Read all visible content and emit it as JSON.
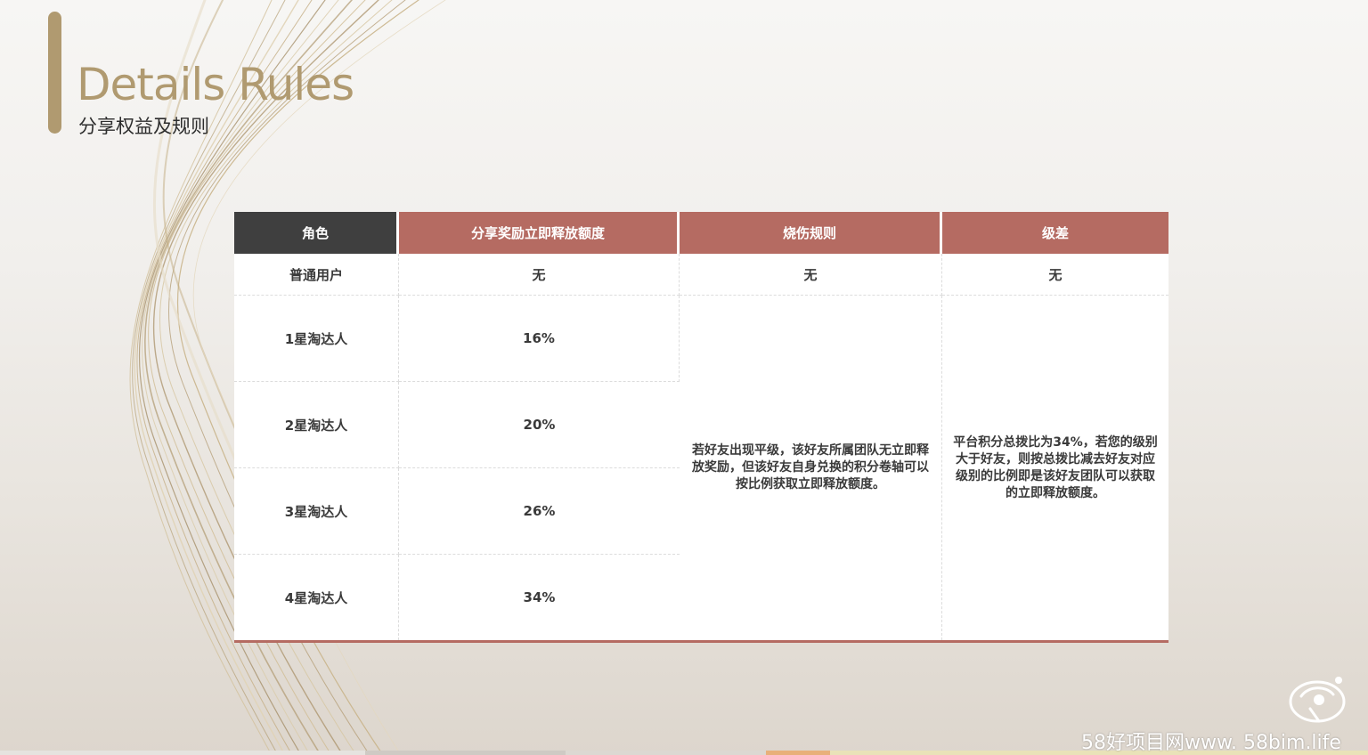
{
  "slide": {
    "title_en": "Details Rules",
    "title_cn": "分享权益及规则"
  },
  "colors": {
    "gold": "#b09a70",
    "header_dark": "#3f3f3f",
    "header_red": "#b56b62"
  },
  "table": {
    "headers": [
      "角色",
      "分享奖励立即释放额度",
      "烧伤规则",
      "级差"
    ],
    "rows": [
      {
        "role": "普通用户",
        "reward": "无",
        "burn": "无",
        "diff": "无"
      },
      {
        "role": "1星淘达人",
        "reward": "16%"
      },
      {
        "role": "2星淘达人",
        "reward": "20%"
      },
      {
        "role": "3星淘达人",
        "reward": "26%"
      },
      {
        "role": "4星淘达人",
        "reward": "34%"
      }
    ],
    "burn_rule_text": "若好友出现平级，该好友所属团队无立即释放奖励，但该好友自身兑换的积分卷轴可以按比例获取立即释放额度。",
    "level_diff_text": "平台积分总拨比为34%，若您的级别大于好友，则按总拨比减去好友对应级别的比例即是该好友团队可以获取的立即释放额度。"
  },
  "footer": {
    "watermark": "58好项目网www. 58bim.life",
    "logo_icon": "brand-logo-icon"
  }
}
